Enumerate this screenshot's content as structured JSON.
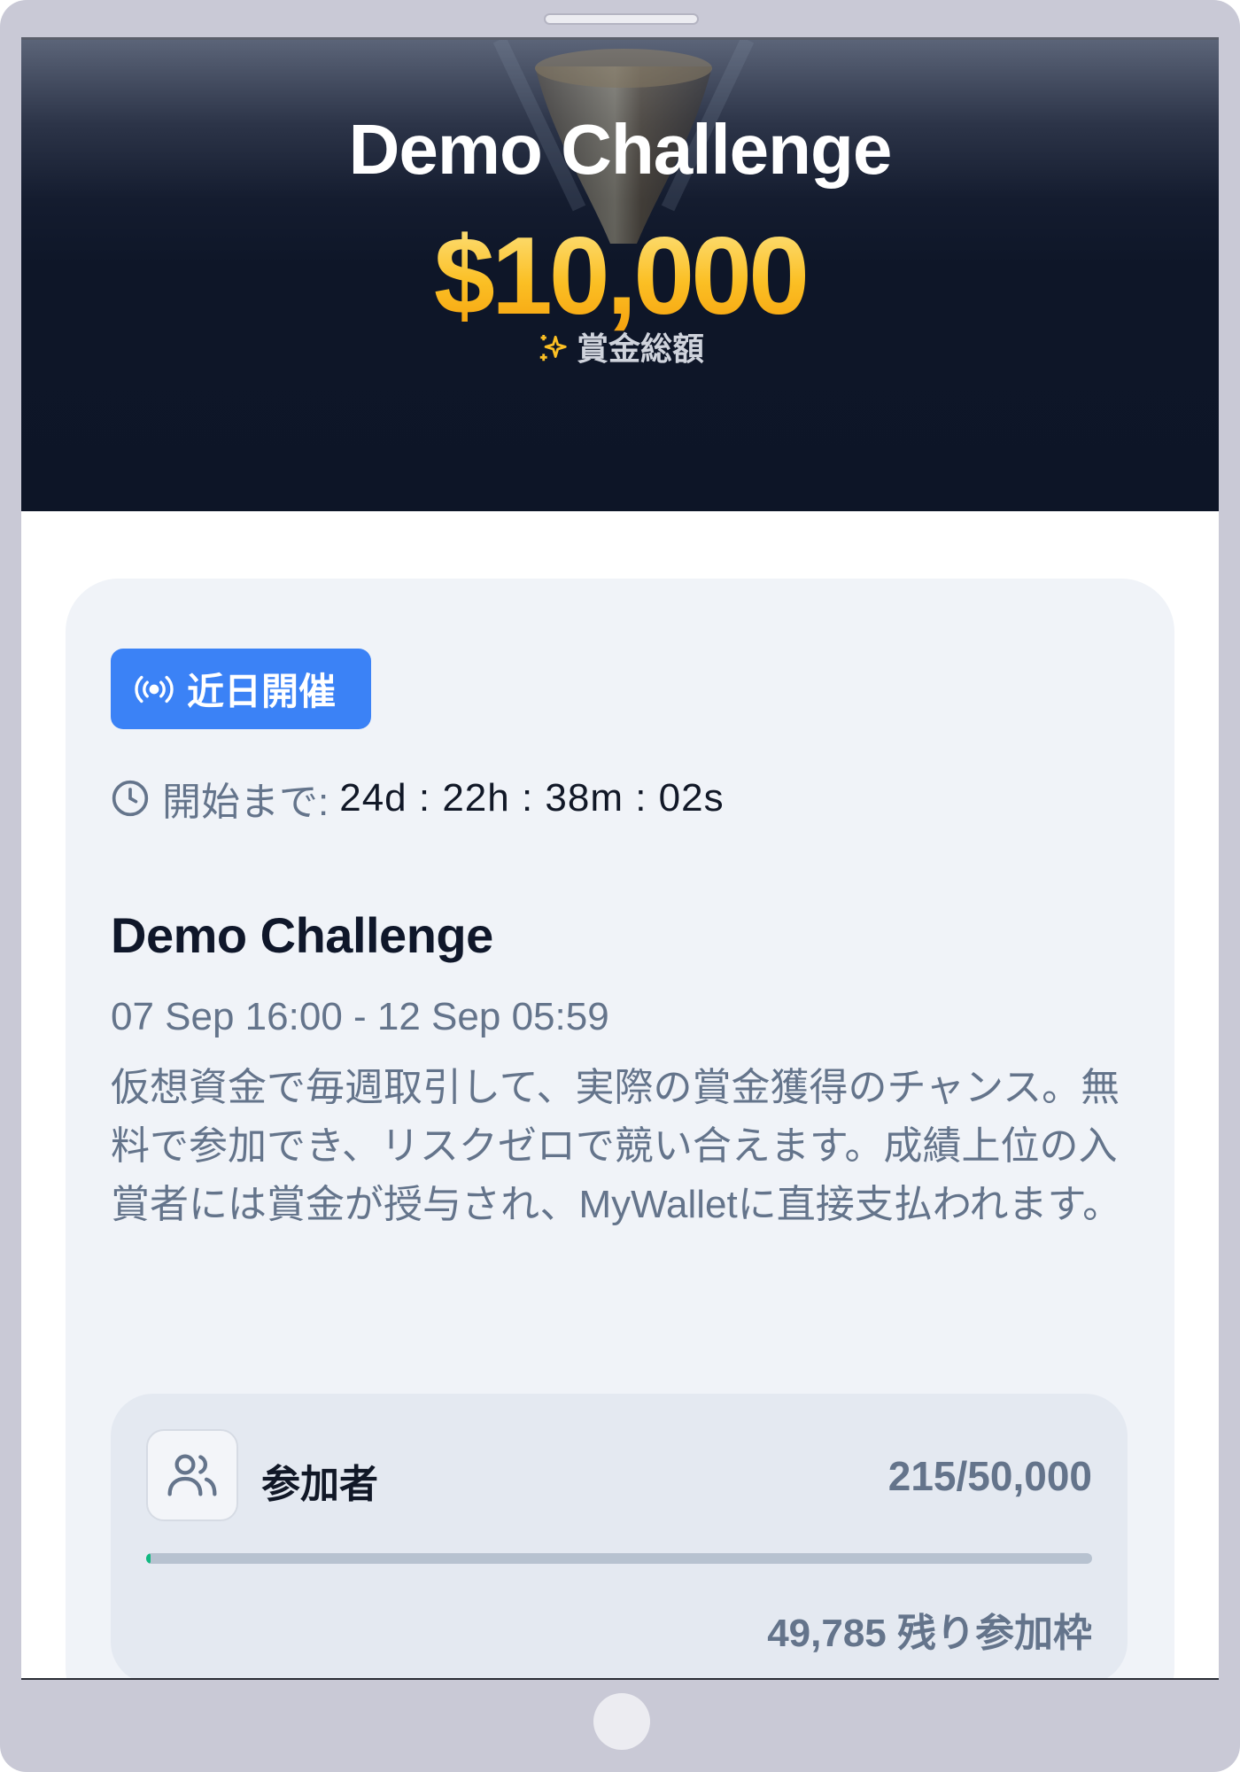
{
  "hero": {
    "title": "Demo Challenge",
    "prize_amount": "$10,000",
    "prize_label": "賞金総額"
  },
  "card": {
    "status_badge": "近日開催",
    "countdown": {
      "label": "開始まで:",
      "time": "24d : 22h : 38m : 02s"
    },
    "title": "Demo Challenge",
    "dates": "07 Sep 16:00 - 12 Sep 05:59",
    "description": "仮想資金で毎週取引して、実際の賞金獲得のチャンス。無料で参加でき、リスクゼロで競い合えます。成績上位の入賞者には賞金が授与され、MyWalletに直接支払われます。"
  },
  "participants": {
    "label": "参加者",
    "count": "215/50,000",
    "progress_fraction": 0.0043,
    "remaining": "49,785 残り参加枠"
  },
  "colors": {
    "accent_blue": "#3b82f6",
    "prize_gold": "#fbbf24",
    "progress_green": "#10b981",
    "hero_dark": "#0d1527"
  },
  "icons": {
    "sparkle": "sparkle-icon",
    "broadcast": "broadcast-icon",
    "clock": "clock-icon",
    "participants": "users-icon"
  }
}
